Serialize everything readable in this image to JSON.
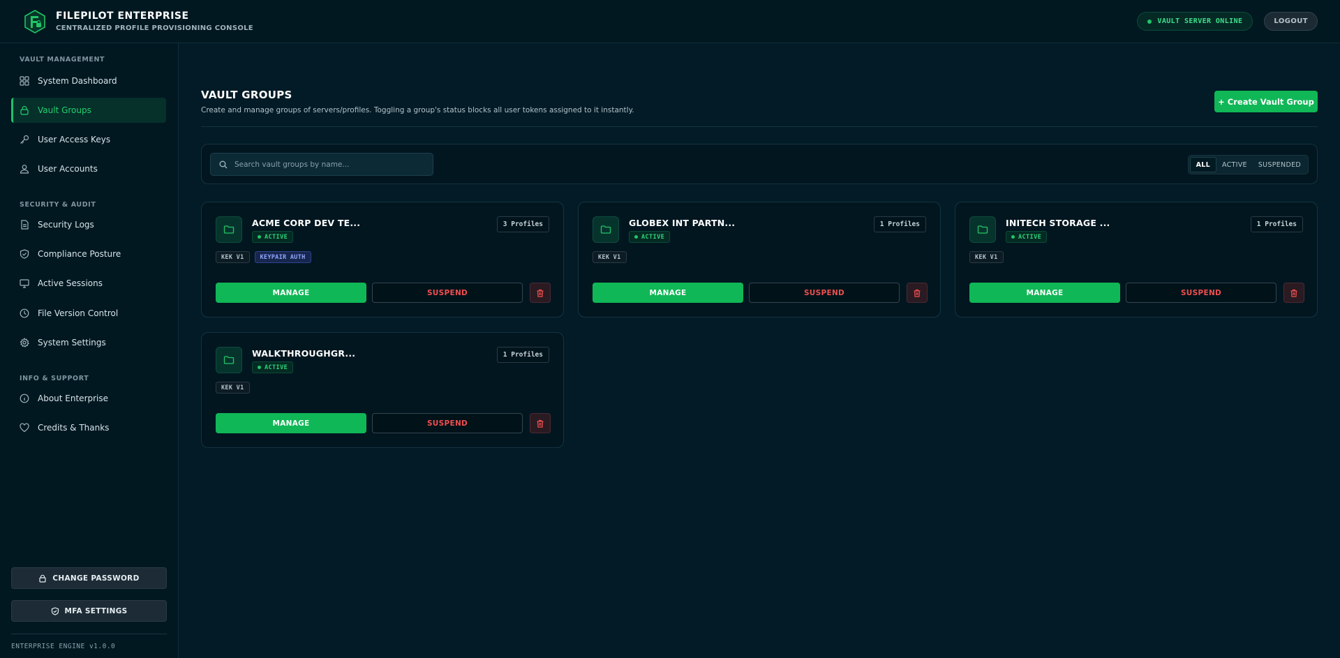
{
  "header": {
    "brand_title": "FILEPILOT ENTERPRISE",
    "brand_subtitle": "CENTRALIZED PROFILE PROVISIONING CONSOLE",
    "vault_status": "VAULT SERVER ONLINE",
    "logout_label": "LOGOUT"
  },
  "sidebar": {
    "sections": [
      {
        "title": "VAULT MANAGEMENT",
        "items": [
          {
            "label": "System Dashboard",
            "icon": "grid-icon",
            "active": false
          },
          {
            "label": "Vault Groups",
            "icon": "lock-icon",
            "active": true
          },
          {
            "label": "User Access Keys",
            "icon": "key-icon",
            "active": false
          },
          {
            "label": "User Accounts",
            "icon": "users-icon",
            "active": false
          }
        ]
      },
      {
        "title": "SECURITY & AUDIT",
        "items": [
          {
            "label": "Security Logs",
            "icon": "document-icon",
            "active": false
          },
          {
            "label": "Compliance Posture",
            "icon": "shield-icon",
            "active": false
          },
          {
            "label": "Active Sessions",
            "icon": "monitor-icon",
            "active": false
          },
          {
            "label": "File Version Control",
            "icon": "clock-icon",
            "active": false
          },
          {
            "label": "System Settings",
            "icon": "gear-icon",
            "active": false
          }
        ]
      },
      {
        "title": "INFO & SUPPORT",
        "items": [
          {
            "label": "About Enterprise",
            "icon": "info-icon",
            "active": false
          },
          {
            "label": "Credits & Thanks",
            "icon": "heart-icon",
            "active": false
          }
        ]
      }
    ],
    "change_password_label": "CHANGE PASSWORD",
    "mfa_settings_label": "MFA SETTINGS",
    "engine_version": "ENTERPRISE ENGINE v1.0.0"
  },
  "main": {
    "title": "VAULT GROUPS",
    "description": "Create and manage groups of servers/profiles. Toggling a group's status blocks all user tokens assigned to it instantly.",
    "create_label": "+ Create Vault Group",
    "search": {
      "placeholder": "Search vault groups by name...",
      "value": ""
    },
    "filters": [
      {
        "label": "ALL",
        "selected": true
      },
      {
        "label": "ACTIVE",
        "selected": false
      },
      {
        "label": "SUSPENDED",
        "selected": false
      }
    ],
    "cards": [
      {
        "name": "ACME CORP DEV TE...",
        "status": "ACTIVE",
        "profiles": "3 Profiles",
        "tags": [
          {
            "label": "KEK V1",
            "kind": "kek"
          },
          {
            "label": "KEYPAIR AUTH",
            "kind": "kp"
          }
        ],
        "manage_label": "MANAGE",
        "suspend_label": "SUSPEND"
      },
      {
        "name": "GLOBEX INT PARTN...",
        "status": "ACTIVE",
        "profiles": "1 Profiles",
        "tags": [
          {
            "label": "KEK V1",
            "kind": "kek"
          }
        ],
        "manage_label": "MANAGE",
        "suspend_label": "SUSPEND"
      },
      {
        "name": "INITECH STORAGE ...",
        "status": "ACTIVE",
        "profiles": "1 Profiles",
        "tags": [
          {
            "label": "KEK V1",
            "kind": "kek"
          }
        ],
        "manage_label": "MANAGE",
        "suspend_label": "SUSPEND"
      },
      {
        "name": "WALKTHROUGHGR...",
        "status": "ACTIVE",
        "profiles": "1 Profiles",
        "tags": [
          {
            "label": "KEK V1",
            "kind": "kek"
          }
        ],
        "manage_label": "MANAGE",
        "suspend_label": "SUSPEND"
      }
    ]
  },
  "colors": {
    "background": "#021b26",
    "accent_green": "#10b756",
    "danger_red": "#ef4f4f",
    "keypair_blue": "#8fa6ff"
  }
}
